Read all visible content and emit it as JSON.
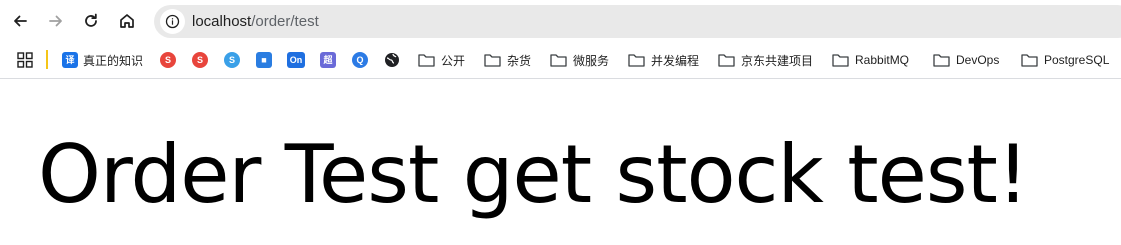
{
  "browser": {
    "url_host": "localhost",
    "url_path": "/order/test",
    "icons": {
      "back": "arrow-left-icon",
      "forward": "arrow-right-icon",
      "reload": "reload-icon",
      "home": "home-icon",
      "site_info": "info-icon",
      "apps": "apps-grid-icon"
    }
  },
  "bookmarks": {
    "items": [
      {
        "label": "真正的知识",
        "icon": "translate-icon",
        "color": "#1a73e8",
        "glyph": "译"
      },
      {
        "label": "",
        "icon": "red-swirl-icon",
        "color": "#e8453c",
        "glyph": "S"
      },
      {
        "label": "",
        "icon": "red-swirl-icon-2",
        "color": "#e8453c",
        "glyph": "S"
      },
      {
        "label": "",
        "icon": "blue-swirl-icon",
        "color": "#3aa0e8",
        "glyph": "S"
      },
      {
        "label": "",
        "icon": "blue-chat-icon",
        "color": "#2a7de1",
        "glyph": "■"
      },
      {
        "label": "",
        "icon": "onenote-on-icon",
        "color": "#1f6fe0",
        "glyph": "On"
      },
      {
        "label": "",
        "icon": "purple-app-icon",
        "color": "#6a6ad8",
        "glyph": "超"
      },
      {
        "label": "",
        "icon": "search-magnifier-icon",
        "color": "#2c7be5",
        "glyph": "Q"
      },
      {
        "label": "",
        "icon": "globe-icon",
        "color": "#202124",
        "glyph": "●"
      },
      {
        "label": "公开",
        "icon": "folder-icon"
      },
      {
        "label": "杂货",
        "icon": "folder-icon"
      },
      {
        "label": "微服务",
        "icon": "folder-icon"
      },
      {
        "label": "并发编程",
        "icon": "folder-icon"
      },
      {
        "label": "京东共建项目",
        "icon": "folder-icon"
      },
      {
        "label": "RabbitMQ",
        "icon": "folder-icon"
      },
      {
        "label": "DevOps",
        "icon": "folder-icon"
      },
      {
        "label": "PostgreSQL",
        "icon": "folder-icon"
      }
    ]
  },
  "page": {
    "heading": "Order Test get stock test!"
  }
}
